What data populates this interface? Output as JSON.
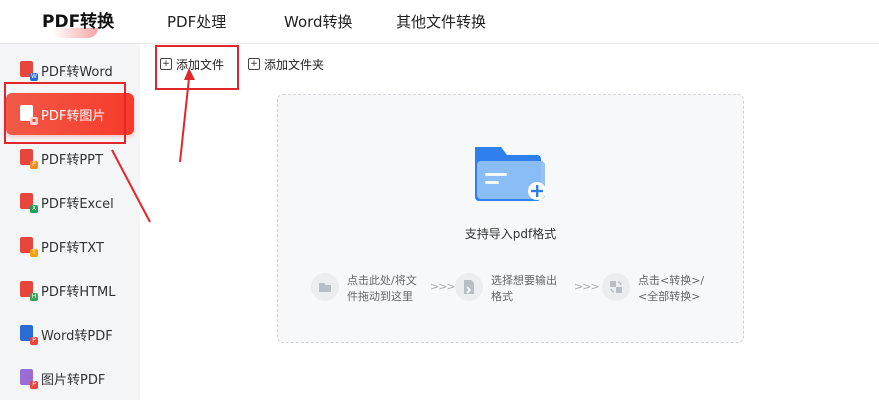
{
  "top_tabs": [
    {
      "label": "PDF转换",
      "active": true
    },
    {
      "label": "PDF处理",
      "active": false
    },
    {
      "label": "Word转换",
      "active": false
    },
    {
      "label": "其他文件转换",
      "active": false
    }
  ],
  "sidebar": {
    "items": [
      {
        "label": "PDF转Word",
        "icon": "pdf-word-file-icon",
        "active": false
      },
      {
        "label": "PDF转图片",
        "icon": "pdf-image-file-icon",
        "active": true
      },
      {
        "label": "PDF转PPT",
        "icon": "pdf-ppt-file-icon",
        "active": false
      },
      {
        "label": "PDF转Excel",
        "icon": "pdf-excel-file-icon",
        "active": false
      },
      {
        "label": "PDF转TXT",
        "icon": "pdf-txt-file-icon",
        "active": false
      },
      {
        "label": "PDF转HTML",
        "icon": "pdf-html-file-icon",
        "active": false
      },
      {
        "label": "Word转PDF",
        "icon": "word-pdf-file-icon",
        "active": false
      },
      {
        "label": "图片转PDF",
        "icon": "image-pdf-file-icon",
        "active": false
      }
    ]
  },
  "toolbar": {
    "add_file_label": "添加文件",
    "add_folder_label": "添加文件夹"
  },
  "dropzone": {
    "hint": "支持导入pdf格式",
    "steps": [
      {
        "line1": "点击此处/将文",
        "line2": "件拖动到这里",
        "icon": "folder-icon"
      },
      {
        "line1": "选择想要输出",
        "line2": "格式",
        "icon": "format-icon"
      },
      {
        "line1": "点击<转换>/",
        "line2": "<全部转换>",
        "icon": "convert-icon"
      }
    ],
    "arrow": ">>>"
  },
  "colors": {
    "accent": "#f5412f",
    "annotation_red": "#e3262b",
    "folder_blue": "#2f80ed",
    "sidebar_bg": "#f4f5f7"
  }
}
